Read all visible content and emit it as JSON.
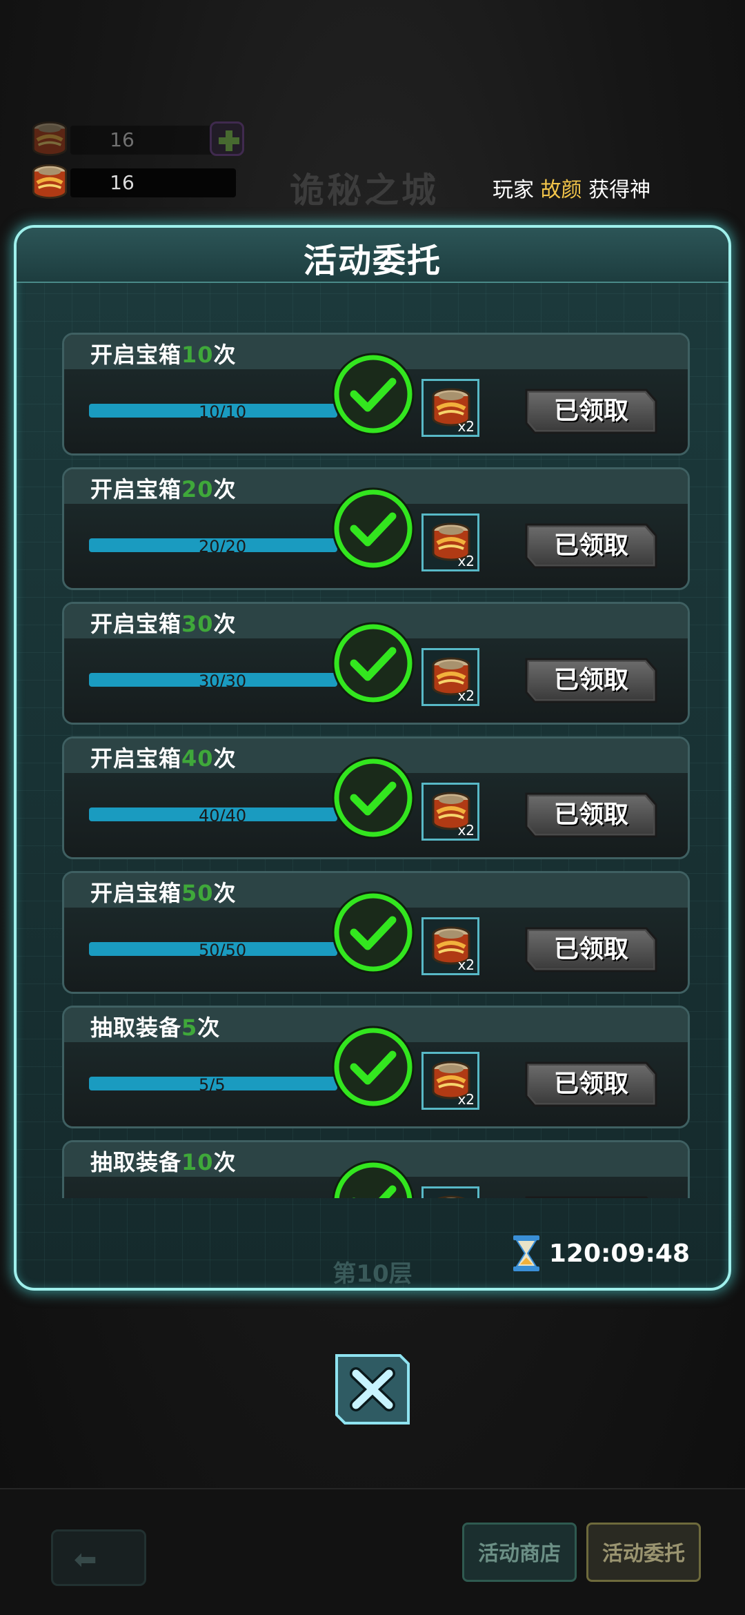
{
  "resources": [
    {
      "value": "16",
      "icon": "canned-food-icon"
    },
    {
      "value": "16",
      "icon": "canned-food-icon"
    }
  ],
  "background": {
    "title": "诡秘之城",
    "ticker": {
      "prefix": "玩家",
      "player": "故颜",
      "suffix": "获得神"
    },
    "floor": "第10层"
  },
  "modal": {
    "title": "活动委托",
    "timer": "120:09:48",
    "tasks": [
      {
        "label": "开启宝箱",
        "num": "10",
        "unit": "次",
        "progress": "10/10",
        "fraction": 1,
        "reward_qty": "x2",
        "claim_label": "已领取"
      },
      {
        "label": "开启宝箱",
        "num": "20",
        "unit": "次",
        "progress": "20/20",
        "fraction": 1,
        "reward_qty": "x2",
        "claim_label": "已领取"
      },
      {
        "label": "开启宝箱",
        "num": "30",
        "unit": "次",
        "progress": "30/30",
        "fraction": 1,
        "reward_qty": "x2",
        "claim_label": "已领取"
      },
      {
        "label": "开启宝箱",
        "num": "40",
        "unit": "次",
        "progress": "40/40",
        "fraction": 1,
        "reward_qty": "x2",
        "claim_label": "已领取"
      },
      {
        "label": "开启宝箱",
        "num": "50",
        "unit": "次",
        "progress": "50/50",
        "fraction": 1,
        "reward_qty": "x2",
        "claim_label": "已领取"
      },
      {
        "label": "抽取装备",
        "num": "5",
        "unit": "次",
        "progress": "5/5",
        "fraction": 1,
        "reward_qty": "x2",
        "claim_label": "已领取"
      },
      {
        "label": "抽取装备",
        "num": "10",
        "unit": "次",
        "progress": "",
        "fraction": 1,
        "reward_qty": "",
        "claim_label": ""
      }
    ]
  },
  "tabs": {
    "shop": "活动商店",
    "commission": "活动委托"
  },
  "colors": {
    "accent": "#9ff0ec",
    "check_green": "#33e61f",
    "highlight": "#f3c54a",
    "progress": "#1a9bc0"
  }
}
